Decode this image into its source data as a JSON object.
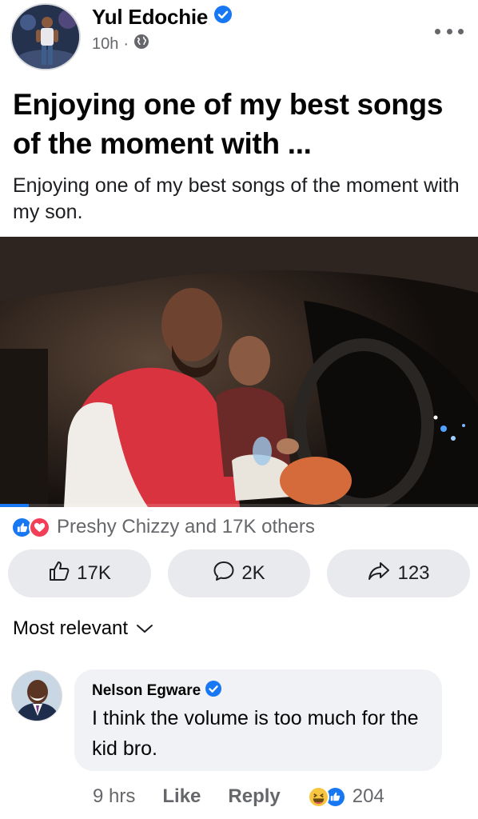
{
  "post": {
    "author": "Yul Edochie",
    "time": "10h",
    "separator": "·",
    "title": "Enjoying one of my best songs of the moment with ...",
    "description": "Enjoying one of my best songs of the moment with my son.",
    "video_progress": 0.06
  },
  "reactions": {
    "summary": "Preshy Chizzy and 17K others",
    "icons": [
      "like-icon",
      "love-icon"
    ]
  },
  "actions": {
    "like_count": "17K",
    "comment_count": "2K",
    "share_count": "123"
  },
  "comments": {
    "sort_label": "Most relevant",
    "items": [
      {
        "name": "Nelson Egware",
        "text": "I think the volume is too much for the kid bro.",
        "time": "9 hrs",
        "like_label": "Like",
        "reply_label": "Reply",
        "reaction_count": "204",
        "reaction_icons": [
          "haha-icon",
          "like-icon"
        ]
      }
    ]
  },
  "colors": {
    "accent": "#1877f2",
    "love": "#f33e58",
    "secondary_text": "#65676b",
    "button_bg": "#e8eaed",
    "bubble_bg": "#f0f2f5"
  }
}
